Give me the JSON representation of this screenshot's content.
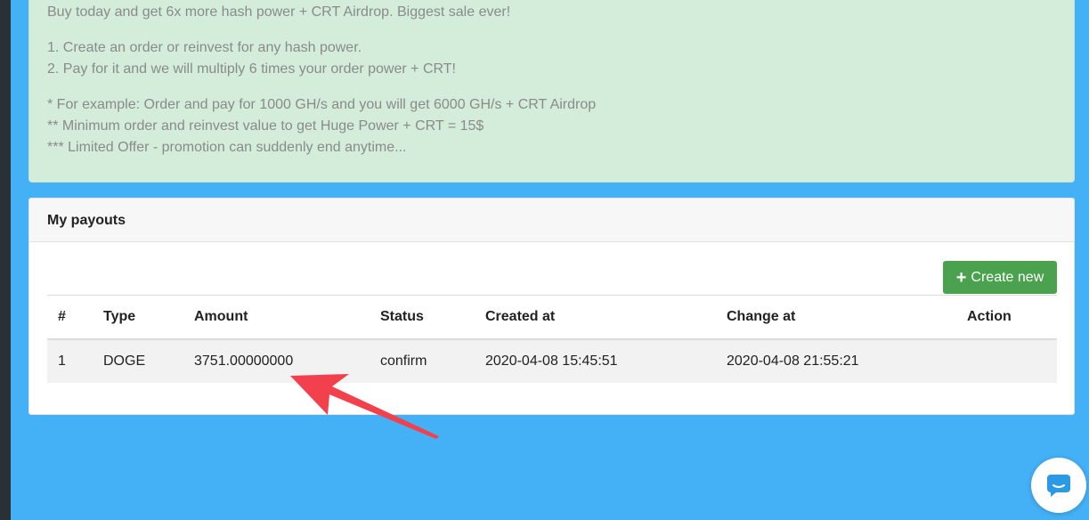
{
  "promo": {
    "line1": "Buy today and get 6x more hash power + CRT Airdrop. Biggest sale ever!",
    "step1": "1. Create an order or reinvest for any hash power.",
    "step2": "2. Pay for it and we will multiply 6 times your order power + CRT!",
    "note1": "* For example: Order and pay for 1000 GH/s and you will get 6000 GH/s + CRT Airdrop",
    "note2": "** Minimum order and reinvest value to get Huge Power + CRT = 15$",
    "note3": "*** Limited Offer - promotion can suddenly end anytime..."
  },
  "payouts": {
    "title": "My payouts",
    "create_label": "Create new",
    "columns": [
      "#",
      "Type",
      "Amount",
      "Status",
      "Created at",
      "Change at",
      "Action"
    ],
    "rows": [
      [
        "1",
        "DOGE",
        "3751.00000000",
        "confirm",
        "2020-04-08 15:45:51",
        "2020-04-08 21:55:21",
        ""
      ]
    ]
  },
  "icons": {
    "create": "plus-icon",
    "chat": "chat-bubble-icon",
    "annotation": "red-arrow-icon"
  },
  "colors": {
    "page_background": "#44b0f5",
    "alert_background": "#d4eddb",
    "create_button": "#4aa24f",
    "annotation_arrow": "#f2404c",
    "chat_icon": "#2b9ae6"
  }
}
